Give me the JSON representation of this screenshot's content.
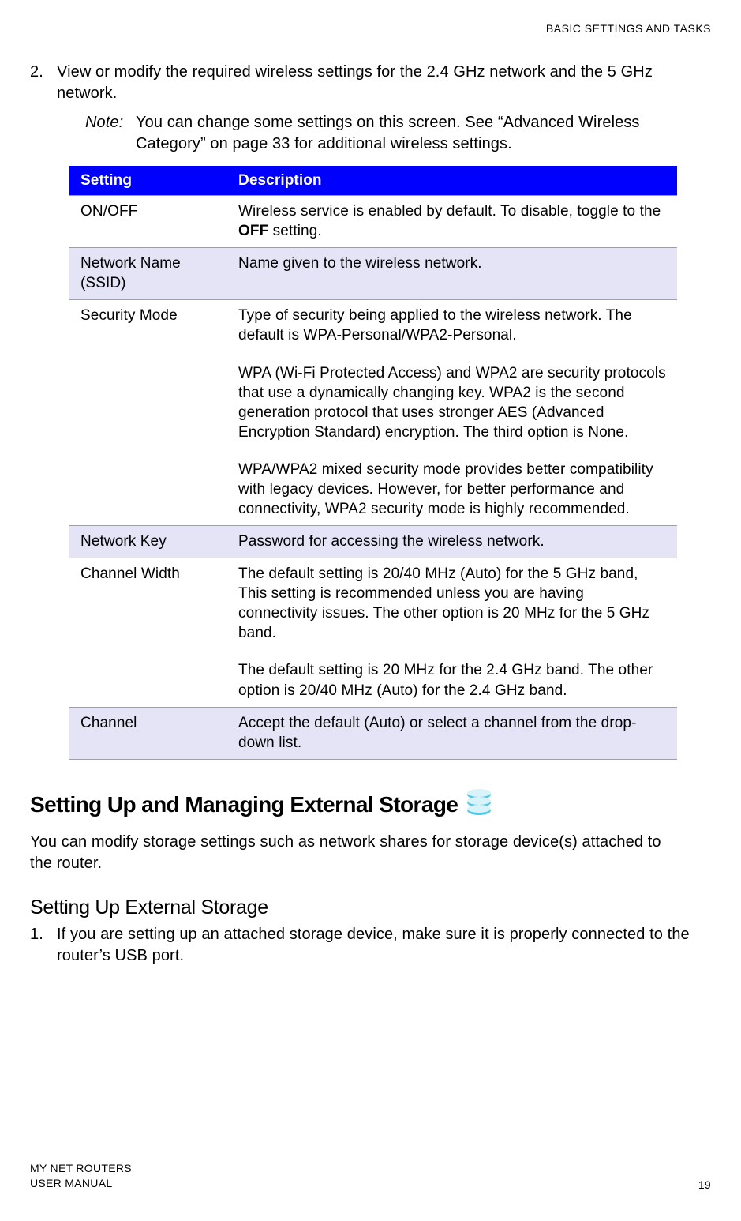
{
  "header": {
    "running_title": "BASIC SETTINGS AND TASKS"
  },
  "step2": {
    "number": "2.",
    "text": "View or modify the required wireless settings for the 2.4 GHz network and the 5 GHz network."
  },
  "note": {
    "label": "Note:",
    "text": "You can change some settings on this screen. See “Advanced Wireless Category” on page 33 for additional wireless settings."
  },
  "table": {
    "headers": {
      "c1": "Setting",
      "c2": "Description"
    },
    "rows": [
      {
        "setting": "ON/OFF",
        "paras": [
          {
            "prefix": "Wireless service is enabled by default. To disable, toggle to the ",
            "bold": "OFF",
            "suffix": " setting."
          }
        ]
      },
      {
        "setting": "Network Name (SSID)",
        "paras": [
          {
            "text": "Name given to the wireless network."
          }
        ]
      },
      {
        "setting": "Security Mode",
        "paras": [
          {
            "text": "Type of security being applied to the wireless network. The default is WPA-Personal/WPA2-Personal."
          },
          {
            "text": "WPA (Wi-Fi Protected Access) and WPA2 are security protocols that use a dynamically changing key. WPA2 is the second generation protocol that uses stronger AES (Advanced Encryption Standard) encryption. The third option is None."
          },
          {
            "text": "WPA/WPA2 mixed security mode provides better compatibility with legacy devices. However, for better performance and connectivity, WPA2 security mode is highly recommended."
          }
        ]
      },
      {
        "setting": "Network Key",
        "paras": [
          {
            "text": "Password for accessing the wireless network."
          }
        ]
      },
      {
        "setting": "Channel Width",
        "paras": [
          {
            "text": "The default setting is 20/40 MHz (Auto) for the 5 GHz band, This setting is recommended unless you are having connectivity issues. The other option is 20 MHz for the 5 GHz band."
          },
          {
            "text": "The default setting is 20 MHz for the 2.4 GHz band. The other option is 20/40 MHz (Auto) for the 2.4 GHz band."
          }
        ]
      },
      {
        "setting": "Channel",
        "paras": [
          {
            "text": "Accept the default (Auto) or select a channel from the drop-down list."
          }
        ]
      }
    ]
  },
  "section": {
    "title": "Setting Up and Managing External Storage",
    "intro": "You can modify storage settings such as network shares for storage device(s) attached to the router."
  },
  "subsection": {
    "title": "Setting Up External Storage",
    "step1": {
      "number": "1.",
      "text": "If you are setting up an attached storage device, make sure it is properly connected to the router’s USB port."
    }
  },
  "footer": {
    "line1": "MY NET ROUTERS",
    "line2": "USER MANUAL",
    "page": "19"
  }
}
